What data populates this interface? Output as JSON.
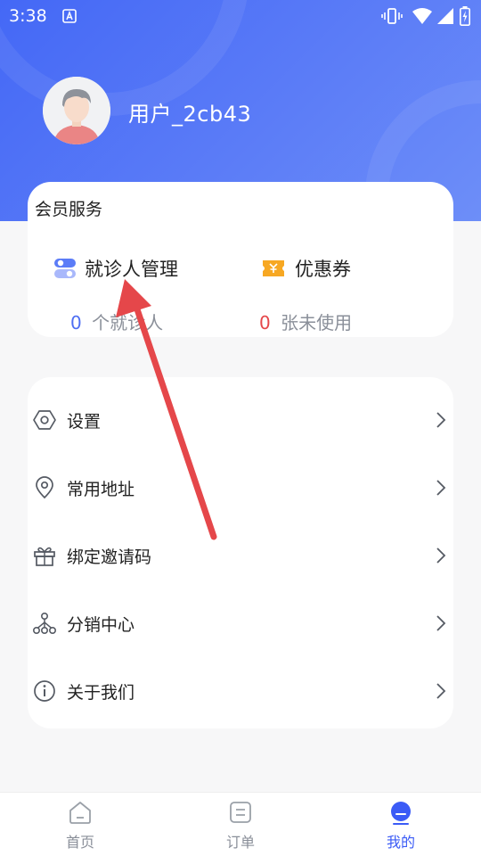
{
  "status_bar": {
    "time": "3:38"
  },
  "profile": {
    "username": "用户_2cb43"
  },
  "member_services": {
    "title": "会员服务",
    "items": [
      {
        "label": "就诊人管理",
        "count": "0",
        "count_suffix": "个就诊人",
        "icon": "toggle-icon"
      },
      {
        "label": "优惠券",
        "count": "0",
        "count_suffix": "张未使用",
        "icon": "coupon-icon"
      }
    ]
  },
  "menu": {
    "items": [
      {
        "label": "设置",
        "icon": "settings-icon"
      },
      {
        "label": "常用地址",
        "icon": "location-icon"
      },
      {
        "label": "绑定邀请码",
        "icon": "gift-icon"
      },
      {
        "label": "分销中心",
        "icon": "network-icon"
      },
      {
        "label": "关于我们",
        "icon": "info-icon"
      }
    ]
  },
  "tabbar": {
    "items": [
      {
        "label": "首页",
        "icon": "home-icon"
      },
      {
        "label": "订单",
        "icon": "order-icon"
      },
      {
        "label": "我的",
        "icon": "profile-icon",
        "active": true
      }
    ]
  },
  "colors": {
    "primary": "#3b5bf6",
    "annotation_arrow": "#e5474a",
    "coupon": "#f7a823",
    "zero_count_blue": "#4e6ef2",
    "zero_count_red": "#e5474a"
  }
}
